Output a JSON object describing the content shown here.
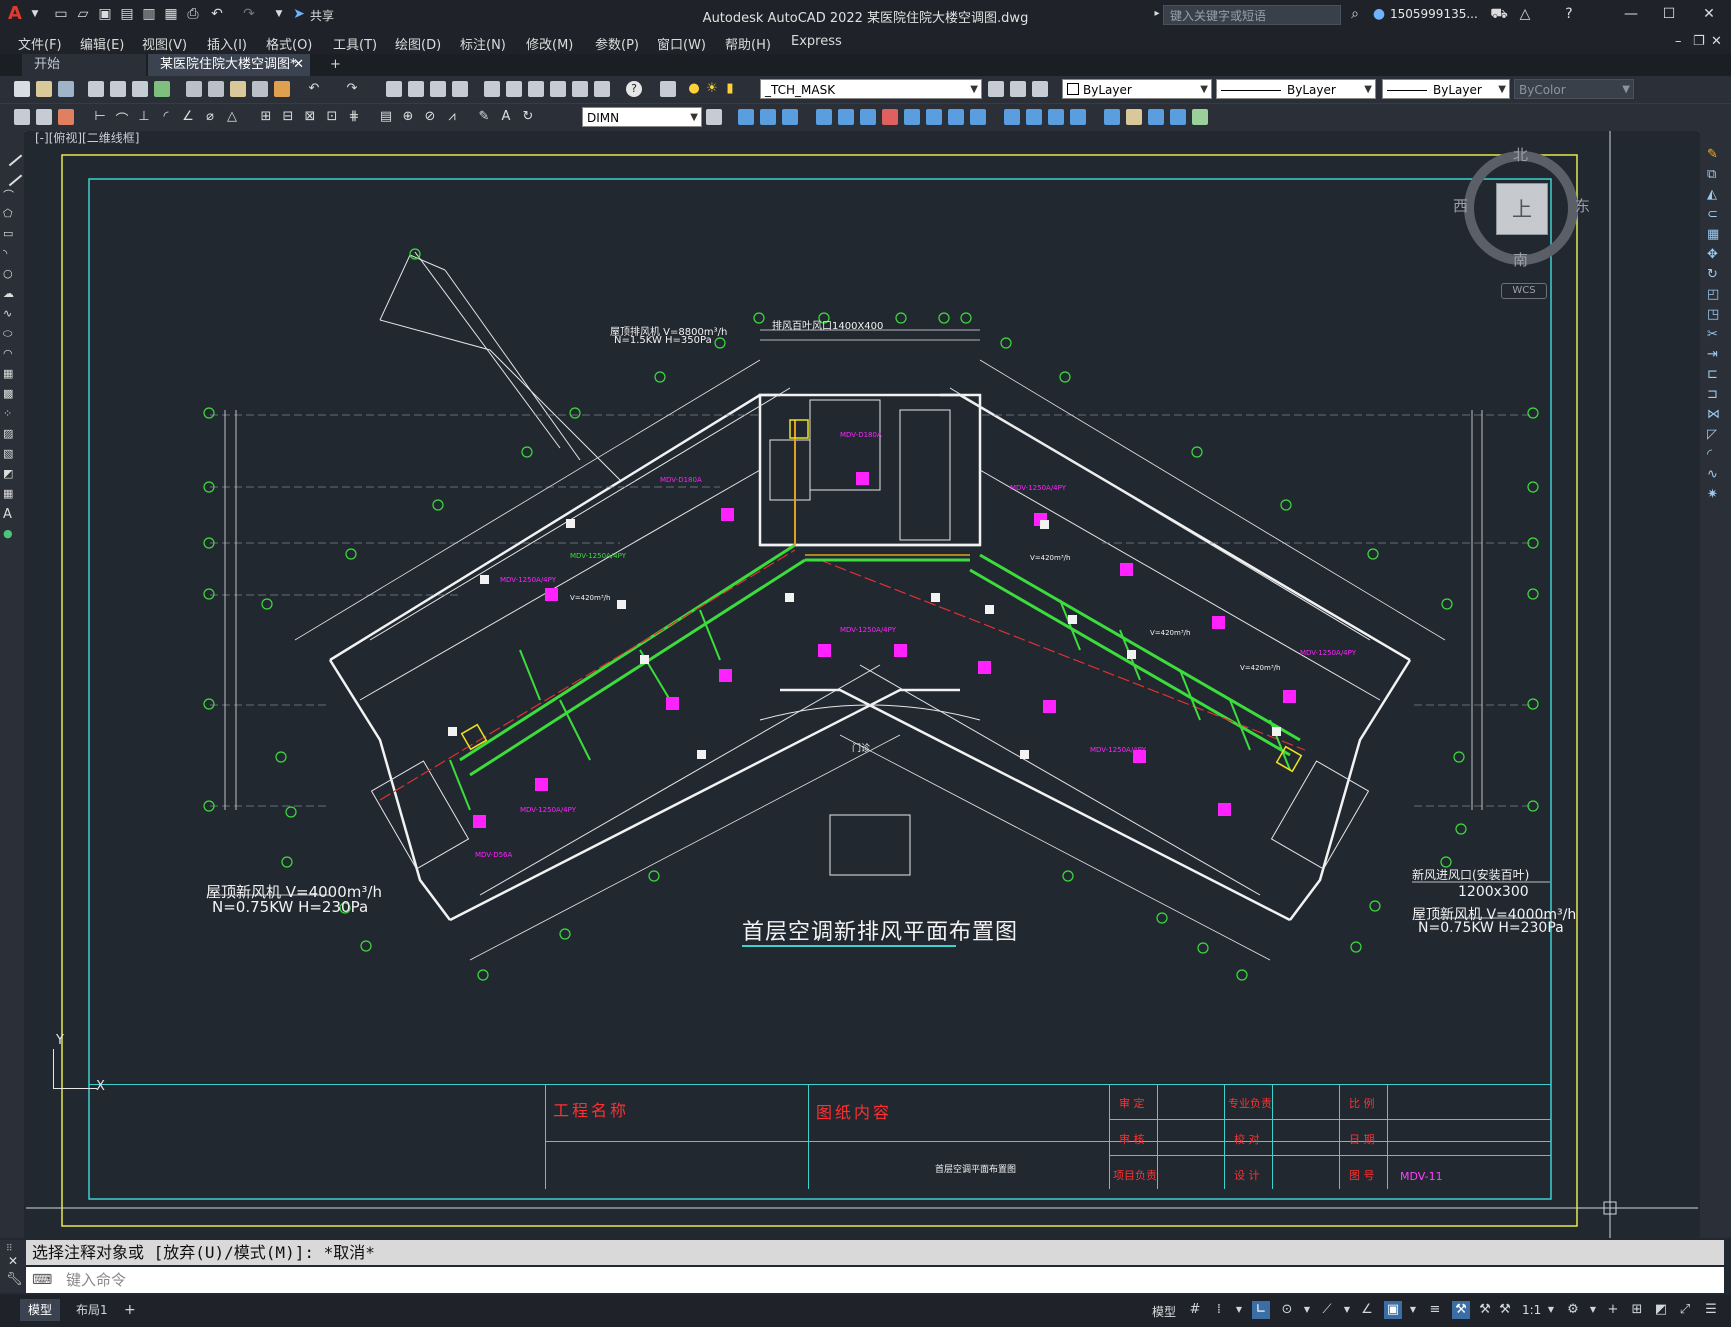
{
  "app": {
    "title": "Autodesk AutoCAD 2022    某医院住院大楼空调图.dwg",
    "search_placeholder": "键入关键字或短语",
    "user": "1505999135...",
    "share": "共享"
  },
  "menus": [
    "文件(F)",
    "编辑(E)",
    "视图(V)",
    "插入(I)",
    "格式(O)",
    "工具(T)",
    "绘图(D)",
    "标注(N)",
    "修改(M)",
    "参数(P)",
    "窗口(W)",
    "帮助(H)",
    "Express"
  ],
  "tabs": {
    "start": "开始",
    "active": "某医院住院大楼空调图*",
    "add": "+"
  },
  "toolbar": {
    "layer": "_TCH_MASK",
    "color": "ByLayer",
    "linetype": "ByLayer",
    "lineweight": "ByLayer",
    "plotstyle": "ByColor",
    "dimstyle": "DIMN"
  },
  "viewport_label": "[-][俯视][二维线框]",
  "viewcube": {
    "north": "北",
    "south": "南",
    "east": "东",
    "west": "西",
    "top": "上",
    "wcs": "WCS"
  },
  "drawing": {
    "plan_title": "首层空调新排风平面布置图",
    "fan_left_1": "屋顶新风机 V=4000m³/h",
    "fan_left_2": "N=0.75KW H=230Pa",
    "fan_right_1": "屋顶新风机 V=4000m³/h",
    "fan_right_2": "N=0.75KW H=230Pa",
    "fresh_air_inlet": "新风进风口(安装百叶)",
    "inlet_size": "1200x300",
    "exhaust_top_1": "屋顶排风机 V=8800m³/h",
    "exhaust_top_2": "N=1.5KW H=350Pa",
    "louver_top": "排风百叶风口1400X400",
    "door": "门诊"
  },
  "titleblock": {
    "project_name": "工程名称",
    "drawing_content": "图纸内容",
    "content_value": "首层空调平面布置图",
    "approve": "审 定",
    "review": "审 核",
    "project_lead": "项目负责",
    "specialty_lead": "专业负责",
    "check": "校 对",
    "design": "设 计",
    "scale": "比 例",
    "date": "日 期",
    "drawing_no": "图 号",
    "drawing_no_value": "MDV-11"
  },
  "command": {
    "history": "选择注释对象或 [放弃(U)/模式(M)]: *取消*",
    "placeholder": "键入命令"
  },
  "status": {
    "model_tab": "模型",
    "layout_tab": "布局1",
    "model_btn": "模型",
    "scale": "1:1"
  }
}
